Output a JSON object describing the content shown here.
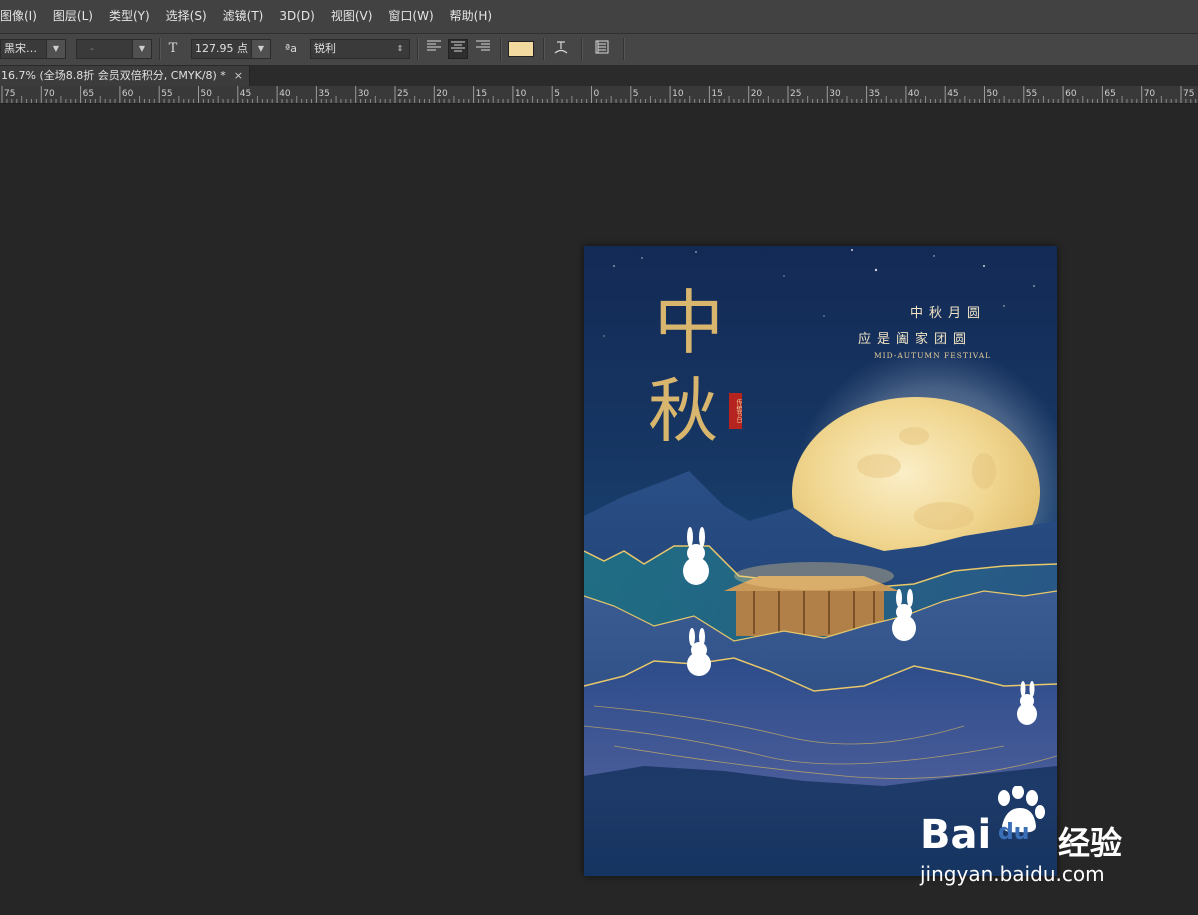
{
  "menubar": {
    "items": [
      "图像(I)",
      "图层(L)",
      "类型(Y)",
      "选择(S)",
      "滤镜(T)",
      "3D(D)",
      "视图(V)",
      "窗口(W)",
      "帮助(H)"
    ]
  },
  "options": {
    "font_family": "黑宋…",
    "font_style": "-",
    "font_size": "127.95 点",
    "antialias_label": "ªa",
    "antialias_value": "锐利",
    "text_color": "#f2d9a0"
  },
  "document_tab": {
    "title": "16.7% (全场8.8折 会员双倍积分, CMYK/8) *",
    "close": "×"
  },
  "ruler": {
    "labels": [
      "75",
      "70",
      "65",
      "60",
      "55",
      "50",
      "45",
      "40",
      "35",
      "30",
      "25",
      "20",
      "15",
      "10",
      "5",
      "0",
      "5",
      "10",
      "15",
      "20",
      "25",
      "30",
      "35",
      "40",
      "45",
      "50",
      "55",
      "60",
      "65",
      "70",
      "75"
    ]
  },
  "poster": {
    "title_char_1": "中",
    "title_char_2": "秋",
    "seal_text": "传统节日",
    "slogan_line1": "中秋月圆",
    "slogan_line2": "应是阖家团圆",
    "festival_en": "MID-AUTUMN FESTIVAL",
    "accent_gold": "#d9b66e",
    "moon_color": "#f3dca0"
  },
  "watermark": {
    "brand_left": "Bai",
    "brand_right": "du",
    "brand_cn": "经验",
    "url": "jingyan.baidu.com"
  }
}
